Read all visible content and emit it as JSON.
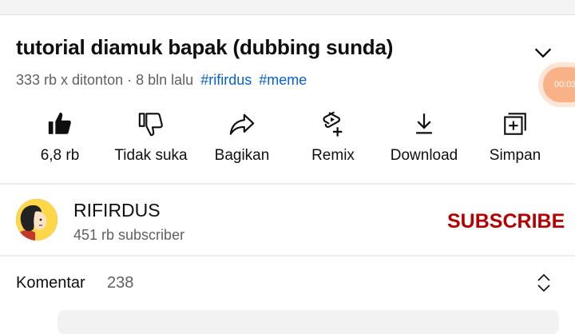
{
  "video": {
    "title": "tutorial diamuk bapak (dubbing sunda)",
    "views": "333 rb x ditonton",
    "separator": "·",
    "age": "8 bln lalu",
    "hashtags": [
      "#rifirdus",
      "#meme"
    ]
  },
  "floating_badge": {
    "text": "00:03"
  },
  "actions": [
    {
      "icon": "thumbs-up-icon",
      "label": "6,8 rb"
    },
    {
      "icon": "thumbs-down-icon",
      "label": "Tidak suka"
    },
    {
      "icon": "share-icon",
      "label": "Bagikan"
    },
    {
      "icon": "remix-icon",
      "label": "Remix"
    },
    {
      "icon": "download-icon",
      "label": "Download"
    },
    {
      "icon": "save-playlist-icon",
      "label": "Simpan"
    }
  ],
  "channel": {
    "name": "RIFIRDUS",
    "subscribers": "451 rb subscriber",
    "subscribe_label": "SUBSCRIBE"
  },
  "comments": {
    "title": "Komentar",
    "count": "238"
  },
  "colors": {
    "link": "#065fd4",
    "subscribe": "#b30000",
    "secondary_text": "#606060"
  }
}
